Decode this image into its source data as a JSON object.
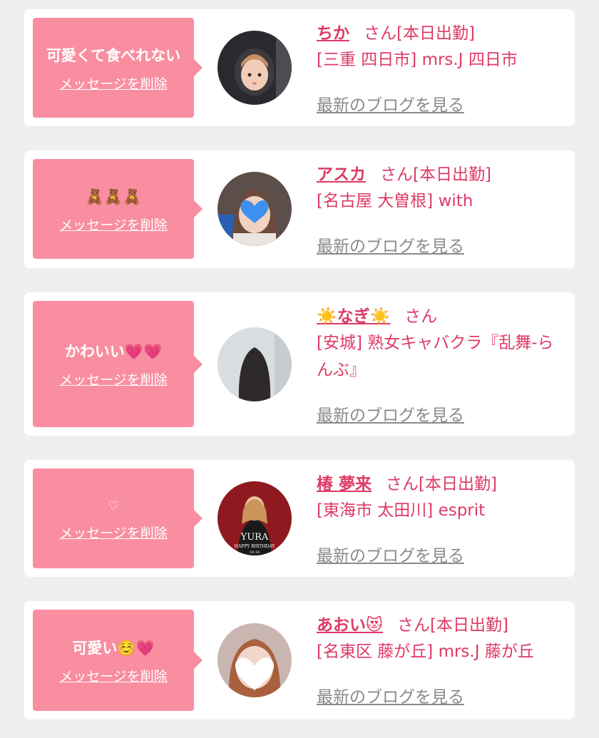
{
  "cards": [
    {
      "message": "可愛くて食べれない",
      "delete_label": "メッセージを削除",
      "name": "ちか",
      "san": "さん",
      "status": "[本日出勤]",
      "shop": "[三重 四日市] mrs.J 四日市",
      "blog_label": "最新のブログを見る"
    },
    {
      "message": "🧸🧸🧸",
      "delete_label": "メッセージを削除",
      "name": "アスカ",
      "san": "さん",
      "status": "[本日出勤]",
      "shop": "[名古屋 大曽根] with",
      "blog_label": "最新のブログを見る"
    },
    {
      "message": "かわいい💗💗",
      "delete_label": "メッセージを削除",
      "name": "☀️なぎ☀️",
      "san": "さん",
      "status": "",
      "shop": "[安城] 熟女キャバクラ『乱舞-らんぶ』",
      "blog_label": "最新のブログを見る"
    },
    {
      "message": "♡",
      "delete_label": "メッセージを削除",
      "name": "椿 夢来",
      "san": "さん",
      "status": "[本日出勤]",
      "shop": "[東海市 太田川] esprit",
      "blog_label": "最新のブログを見る",
      "avatar_text_1": "YURA",
      "avatar_text_2": "HAPPY BIRTHDAY",
      "avatar_text_3": "10.16"
    },
    {
      "message": "可愛い☺️💗",
      "delete_label": "メッセージを削除",
      "name": "あおい😻",
      "san": "さん",
      "status": "[本日出勤]",
      "shop": "[名東区 藤が丘] mrs.J 藤が丘",
      "blog_label": "最新のブログを見る"
    }
  ],
  "colors": {
    "page_bg": "#efefef",
    "card_bg": "#ffffff",
    "bubble_bg": "#f98ea0",
    "accent_text": "#de3a66",
    "link_gray": "#8a8a8a"
  }
}
